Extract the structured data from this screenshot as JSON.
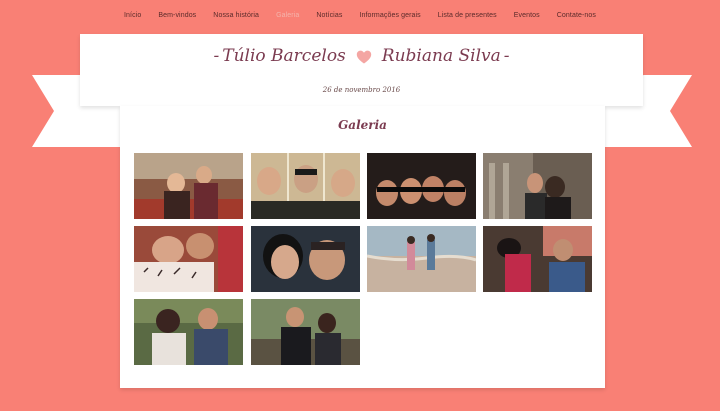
{
  "nav": {
    "items": [
      {
        "label": "Início",
        "active": false
      },
      {
        "label": "Bem-vindos",
        "active": false
      },
      {
        "label": "Nossa história",
        "active": false
      },
      {
        "label": "Galeria",
        "active": true
      },
      {
        "label": "Notícias",
        "active": false
      },
      {
        "label": "Informações gerais",
        "active": false
      },
      {
        "label": "Lista de presentes",
        "active": false
      },
      {
        "label": "Eventos",
        "active": false
      },
      {
        "label": "Contate-nos",
        "active": false
      }
    ]
  },
  "header": {
    "groom": "Túlio Barcelos",
    "bride": "Rubiana Silva",
    "dash": "-",
    "heart_icon": "heart-icon",
    "date": "26 de novembro 2016"
  },
  "gallery": {
    "title": "Galeria",
    "photos": [
      {
        "name": "photo-1",
        "bg": "#7a4a3a"
      },
      {
        "name": "photo-2",
        "bg": "#d8c6a2"
      },
      {
        "name": "photo-3",
        "bg": "#2a2220"
      },
      {
        "name": "photo-4",
        "bg": "#5a5048"
      },
      {
        "name": "photo-5",
        "bg": "#c9a58a"
      },
      {
        "name": "photo-6",
        "bg": "#2c3540"
      },
      {
        "name": "photo-7",
        "bg": "#a7b5be"
      },
      {
        "name": "photo-8",
        "bg": "#4a3a34"
      },
      {
        "name": "photo-9",
        "bg": "#6a7a4a"
      },
      {
        "name": "photo-10",
        "bg": "#6f7a5a"
      }
    ]
  },
  "colors": {
    "background": "#f98075",
    "accent": "#7b3b50",
    "heart": "#f4a6a3",
    "nav_active": "#f4b3ab"
  }
}
